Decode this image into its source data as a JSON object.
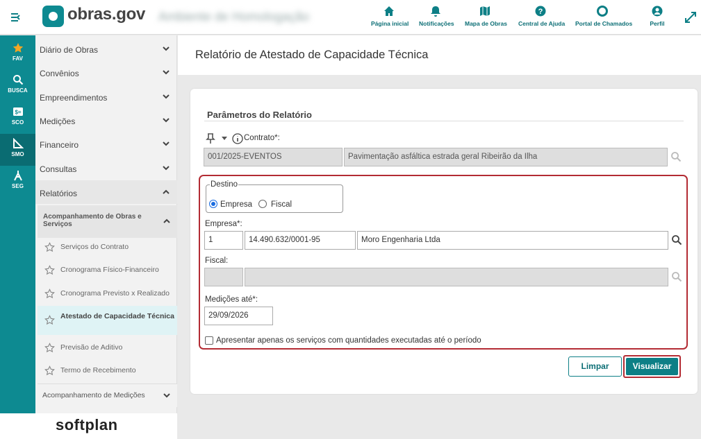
{
  "header": {
    "logo_text": "obras.gov",
    "environment_label": "Ambiente de Homologação",
    "nav": [
      {
        "label": "Página inicial",
        "icon": "home-icon"
      },
      {
        "label": "Notificações",
        "icon": "bell-icon"
      },
      {
        "label": "Mapa de Obras",
        "icon": "map-icon"
      },
      {
        "label": "Central de Ajuda",
        "icon": "help-icon"
      },
      {
        "label": "Portal de Chamados",
        "icon": "lifebuoy-icon"
      },
      {
        "label": "Perfil",
        "icon": "user-icon"
      }
    ]
  },
  "rail": {
    "items": [
      {
        "label": "FAV",
        "icon": "star-icon"
      },
      {
        "label": "BUSCA",
        "icon": "search-icon"
      },
      {
        "label": "SCO",
        "icon": "sco-icon"
      },
      {
        "label": "SMO",
        "icon": "ruler-icon"
      },
      {
        "label": "SEG",
        "icon": "compass-icon"
      }
    ]
  },
  "sidemenu": {
    "items": [
      {
        "label": "Diário de Obras"
      },
      {
        "label": "Convênios"
      },
      {
        "label": "Empreendimentos"
      },
      {
        "label": "Medições"
      },
      {
        "label": "Financeiro"
      },
      {
        "label": "Consultas"
      },
      {
        "label": "Relatórios"
      }
    ],
    "submenu_label": "Acompanhamento de Obras e Serviços",
    "leaves": [
      {
        "label": "Serviços do Contrato"
      },
      {
        "label": "Cronograma Físico-Financeiro"
      },
      {
        "label": "Cronograma Previsto x Realizado"
      },
      {
        "label": "Atestado de Capacidade Técnica"
      },
      {
        "label": "Previsão de Aditivo"
      },
      {
        "label": "Termo de Recebimento"
      }
    ],
    "bottom_item": "Acompanhamento de Medições"
  },
  "footer_brand": "softplan",
  "page": {
    "title": "Relatório de Atestado de Capacidade Técnica"
  },
  "form": {
    "section_title": "Parâmetros do Relatório",
    "contrato_label": "Contrato*:",
    "contrato_code": "001/2025-EVENTOS",
    "contrato_desc": "Pavimentação asfáltica estrada geral Ribeirão da Ilha",
    "destino_legend": "Destino",
    "destino_options": [
      "Empresa",
      "Fiscal"
    ],
    "destino_selected": "Empresa",
    "empresa_label": "Empresa*:",
    "empresa_code": "1",
    "empresa_cnpj": "14.490.632/0001-95",
    "empresa_name": "Moro Engenharia Ltda",
    "fiscal_label": "Fiscal:",
    "fiscal_code": "",
    "fiscal_name": "",
    "medicoes_label": "Medições até*:",
    "medicoes_date": "29/09/2026",
    "checkbox_label": "Apresentar apenas os serviços com quantidades executadas até o período",
    "checkbox_checked": false,
    "btn_limpar": "Limpar",
    "btn_visualizar": "Visualizar"
  },
  "colors": {
    "primary": "#0d8a91",
    "highlight": "#b32b33"
  }
}
